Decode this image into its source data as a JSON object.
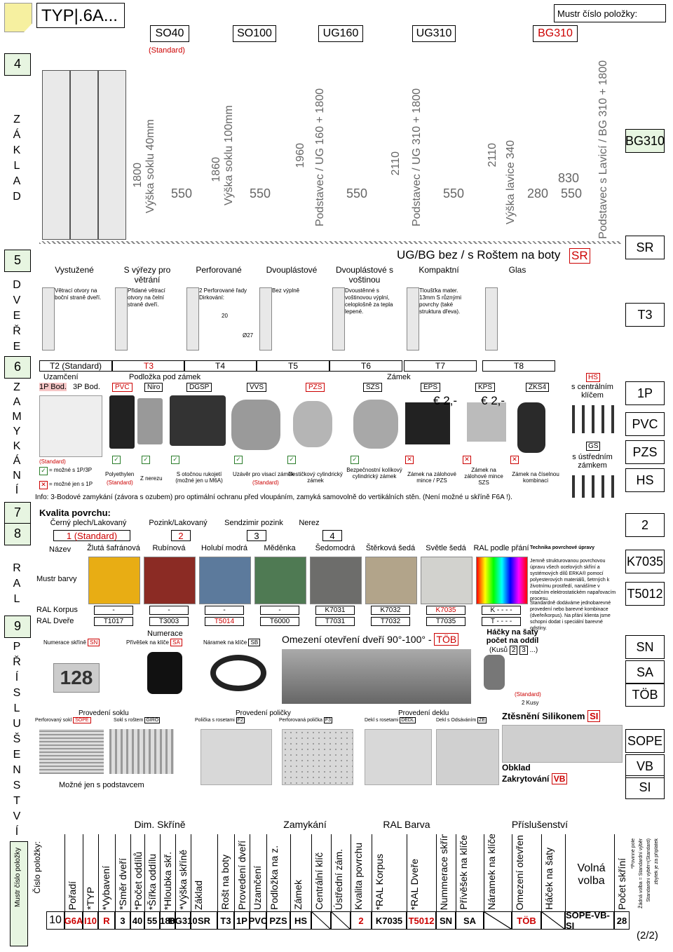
{
  "header": {
    "code": "TYP|.6A...",
    "models": [
      "SO40",
      "SO100",
      "UG160",
      "UG310",
      "BG310"
    ],
    "standard": "(Standard)",
    "mustr": "Mustr číslo položky:",
    "dims": {
      "so40_h": "1800",
      "so40_sokl": "Výška soklu 40mm",
      "so40_w": "550",
      "so100_h": "1860",
      "so100_sokl": "Výška soklu 100mm",
      "so100_w": "550",
      "ug160_h": "1960",
      "ug160_pod": "Podstavec / UG 160 + 1800",
      "ug160_w": "550",
      "ug310_h": "2110",
      "ug310_pod": "Podstavec / UG 310 + 1800",
      "ug310_w": "550",
      "bg_h": "2110",
      "bg_lavice": "Výška lavice 340",
      "bg_d1": "280",
      "bg_d2": "830",
      "bg_w": "550",
      "bg_pod": "Podstavec s Lavicí / BG 310 + 1800"
    }
  },
  "left": {
    "n4": "4",
    "zaklad": [
      "Z",
      "Á",
      "K",
      "L",
      "A",
      "D"
    ],
    "n5": "5",
    "dvere": [
      "D",
      "V",
      "E",
      "Ř",
      "E"
    ],
    "n6": "6",
    "zamykani": [
      "Z",
      "A",
      "M",
      "Y",
      "K",
      "Á",
      "N",
      "Í"
    ],
    "n7": "7",
    "n8": "8",
    "ral": [
      "R",
      "A",
      "L"
    ],
    "n9": "9",
    "prislusenstvi": [
      "P",
      "Ř",
      "Í",
      "S",
      "L",
      "U",
      "Š",
      "E",
      "N",
      "S",
      "T",
      "V",
      "Í"
    ],
    "mustr": "Mustr číslo položky"
  },
  "right": [
    "BG310",
    "SR",
    "T3",
    "1P",
    "PVC",
    "PZS",
    "HS",
    "2",
    "K7035",
    "T5012",
    "SN",
    "SA",
    "TÖB",
    "SOPE",
    "VB",
    "SI"
  ],
  "doors": {
    "title": "UG/BG bez / s Roštem na boty",
    "sr": "SR",
    "types": [
      {
        "name": "Vystužené",
        "desc": "Větrací otvory na boční straně dveří.",
        "code": "T2 (Standard)"
      },
      {
        "name": "S výřezy pro větrání",
        "desc": "Přidané větrací otvory na čelní straně dveří.",
        "code": "T3"
      },
      {
        "name": "Perforované",
        "desc": "2 Perforované řady Dirkování:",
        "d1": "20",
        "d2": "Ø27",
        "code": "T4"
      },
      {
        "name": "Dvouplástové",
        "desc": "Bez výplně",
        "code": "T5"
      },
      {
        "name": "Dvouplástové s voštinou",
        "desc": "Dvoustěnné s voštinovou výplní, celoplošně za tepla lepené.",
        "code": "T6"
      },
      {
        "name": "Kompaktní",
        "desc": "Tloušťka mater. 13mm S různými povrchy (také struktura dřeva).",
        "code": "T7"
      },
      {
        "name": "Glas",
        "desc": "",
        "code": "T8"
      }
    ]
  },
  "locks": {
    "uzamceni": "Uzamčení",
    "podlozka": "Podložka pod zámek",
    "zamek": "Zámek",
    "bod1": "1P Bod.",
    "bod3": "3P Bod.",
    "codes": [
      "PVC",
      "Niro",
      "DGSP",
      "VVS",
      "PZS",
      "SZS",
      "EPS",
      "KPS",
      "ZKS4"
    ],
    "price1": "2,-",
    "price2": "2,-",
    "std": "(Standard)",
    "mozne13": "= možné s 1P/3P",
    "mozne1": "= možné jen s 1P",
    "polyethylen": "Polyethylen",
    "polystd": "(Standard)",
    "nerezu": "Z nerezu",
    "otocnou": "S otočnou rukojetí (možné jen u M6A)",
    "uzaver": "Uzávěr pro visací zámek",
    "uzaverstd": "(Standard)",
    "desticka": "Destičkový cylindrický zámek",
    "bezpec": "Bezpečnostní kolíkový cylindrický zámek",
    "zalohove": "Zámek na zálohové mince / PZS",
    "zalohove2": "Zámek na zálohové mince SZS",
    "ciselnou": "Zámek na číselnou kombinaci",
    "hs": "HS",
    "hs_desc": "s centrálním klíčem",
    "gs": "GS",
    "gs_desc": "s ústředním zámkem",
    "info": "Info: 3-Bodové zamykání (závora s ozubem) pro optimální ochranu před vloupáním, zamyká samovolně do vertikálních stěn. (Není možné u skříně F6A !)."
  },
  "quality": {
    "title": "Kvalita povrchu:",
    "options": [
      "Černý plech/Lakovaný",
      "Pozink/Lakovaný",
      "Sendzimir pozink",
      "Nerez"
    ],
    "values": [
      "1 (Standard)",
      "2",
      "3",
      "4"
    ]
  },
  "ral": {
    "nazev": "Název",
    "mustr": "Mustr barvy",
    "korpus": "RAL Korpus",
    "dvere": "RAL Dveře",
    "colors": [
      {
        "name": "Žlutá šafránová",
        "hex": "#e8ad14",
        "korpus": "-",
        "dvere": "T1017"
      },
      {
        "name": "Rubínová",
        "hex": "#8b2b24",
        "korpus": "-",
        "dvere": "T3003"
      },
      {
        "name": "Holubí modrá",
        "hex": "#5c7a9c",
        "korpus": "-",
        "dvere": "T5014"
      },
      {
        "name": "Měděnka",
        "hex": "#4f7a53",
        "korpus": "-",
        "dvere": "T6000"
      },
      {
        "name": "Šedomodrá",
        "hex": "#6d6d6b",
        "korpus": "K7031",
        "dvere": "T7031"
      },
      {
        "name": "Štěrková šedá",
        "hex": "#b2a48a",
        "korpus": "K7032",
        "dvere": "T7032"
      },
      {
        "name": "Světle šedá",
        "hex": "#d2d2ce",
        "korpus": "K7035",
        "dvere": "T7035"
      },
      {
        "name": "RAL podle přání",
        "hex": "#ffffff",
        "korpus": "K - - - -",
        "dvere": "T - - - -"
      }
    ],
    "tech_title": "Technika povrchové úpravy",
    "tech1": "Jemně strukturovanou povrchovou úpravu všech ocelových skříní a systémových dílů ERKA® pomocí polyesterových materiálů, šetrných k životnímu prostředí, nanášíme v rotačním elektrostatickém napařovacím procesu.",
    "tech2": "Standardně dodáváme jednobarevné provedení nebo barevné kombinace (dveře/korpus). Na přání klienta jsme schopni dodat i speciální barevné odstíny."
  },
  "acc": {
    "numerace": "Numerace",
    "skrine": "Numerace skříně",
    "sn": "SN",
    "privesek": "Přívěšek na klíče",
    "sa": "SA",
    "naramek": "Náramek na klíče",
    "sb": "SB",
    "number": "128",
    "omezeni": "Omezení otevření dveří 90°-100° -",
    "tob": "TÖB",
    "hacky": "Háčky na šaty počet na oddíl",
    "kusu": "(Kusů",
    "k2": "2",
    "k3": "3",
    "kusu2": "...)",
    "hstd": "(Standard)",
    "hkusy": "2 Kusy",
    "soklt": "Provedení soklu",
    "sopet": "Perforovaný sokl",
    "sope": "SOPE",
    "girot": "Sokl s roštem",
    "giro": "GIRO",
    "policky": "Provedení poličky",
    "f2t": "Polička s rosetami",
    "f2": "F2",
    "f3t": "Perforovaná polička",
    "f3": "F3",
    "deklot": "Provedení deklu",
    "dedlt": "Dekl s rosetami",
    "dedl": "DEDL",
    "zet": "Dekl s Odsáváním",
    "ze": "ZE",
    "ztesneni": "Ztěsnění Silikonem",
    "si": "SI",
    "mozne": "Možné jen s podstavcem",
    "obklad": "Obklad",
    "zakryt": "Zakrytování",
    "vb": "VB"
  },
  "bottom": {
    "groups": [
      "Dim. Skříně",
      "Zamykání",
      "RAL Barva",
      "Příslušenství"
    ],
    "cislo": "Číslo položky:",
    "headers": [
      "Pořadí",
      "*TYP",
      "*Vybavení",
      "*Směr dveří",
      "*Počet oddílů",
      "*Šířka oddílu",
      "*Hloubka skř.",
      "*Výška skříně",
      "Základ",
      "Rošt na boty",
      "Provedení dveří",
      "Uzamčení",
      "Podložka na z.",
      "Zámek",
      "Centrální klíč",
      "Ústřední zám.",
      "Kvalita povrchu",
      "*RAL Korpus",
      "*RAL Dveře",
      "Nummerace skříně",
      "Přívěšek na klíče",
      "Náramek na klíče",
      "Omezení otevření dveří na 90°-100°",
      "Háček na šaty",
      "Volná volba",
      "Počet skříní"
    ],
    "values": [
      "10",
      "G6A",
      "I10",
      "R",
      "3",
      "40",
      "55",
      "180",
      "BG310",
      "SR",
      "T3",
      "1P",
      "PVC",
      "PZS",
      "HS",
      "",
      "",
      "2",
      "K7035",
      "T5012",
      "SN",
      "SA",
      "",
      "TÖB",
      "",
      "SOPE-VB-SI",
      "28"
    ],
    "note": [
      "*Povinné pole",
      "Žádná volba = Standardní výběr",
      "Standardní výběr=(Standard)",
      "zbytek je za příplatek"
    ],
    "page": "(2/2)"
  }
}
